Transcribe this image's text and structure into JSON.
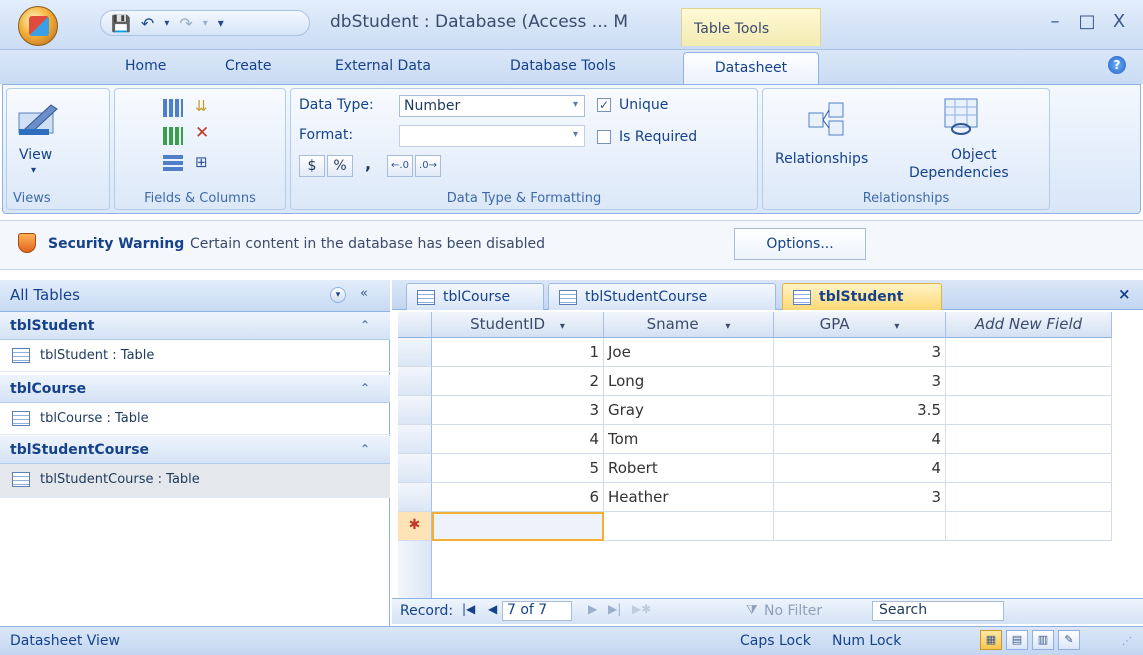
{
  "window": {
    "title": "dbStudent : Database (Access ... M",
    "context_tab": "Table Tools",
    "minimize": "–",
    "maximize": "□",
    "close": "X"
  },
  "ribbon_tabs": [
    "Home",
    "Create",
    "External Data",
    "Database Tools",
    "Datasheet"
  ],
  "ribbon": {
    "views": {
      "view_label": "View",
      "group": "Views"
    },
    "fields": {
      "group": "Fields & Columns"
    },
    "formatting": {
      "data_type_label": "Data Type:",
      "data_type_value": "Number",
      "format_label": "Format:",
      "format_value": "",
      "unique_label": "Unique",
      "required_label": "Is Required",
      "currency": "$",
      "percent": "%",
      "comma": ",",
      "group": "Data Type & Formatting"
    },
    "relationships": {
      "relationships_label": "Relationships",
      "object_label_1": "Object",
      "object_label_2": "Dependencies",
      "group": "Relationships"
    }
  },
  "security": {
    "title": "Security Warning",
    "message": "Certain content in the database has been disabled",
    "options": "Options..."
  },
  "nav": {
    "header": "All Tables",
    "groups": [
      {
        "name": "tblStudent",
        "item": "tblStudent : Table"
      },
      {
        "name": "tblCourse",
        "item": "tblCourse : Table"
      },
      {
        "name": "tblStudentCourse",
        "item": "tblStudentCourse : Table"
      }
    ]
  },
  "doc_tabs": [
    "tblCourse",
    "tblStudentCourse",
    "tblStudent"
  ],
  "table": {
    "columns": [
      "StudentID",
      "Sname",
      "GPA",
      "Add New Field"
    ],
    "rows": [
      [
        "1",
        "Joe",
        "3"
      ],
      [
        "2",
        "Long",
        "3"
      ],
      [
        "3",
        "Gray",
        "3.5"
      ],
      [
        "4",
        "Tom",
        "4"
      ],
      [
        "5",
        "Robert",
        "4"
      ],
      [
        "6",
        "Heather",
        "3"
      ]
    ],
    "new_row_marker": "✱"
  },
  "record_nav": {
    "label": "Record:",
    "position": "7 of 7",
    "filter": "No Filter",
    "search": "Search"
  },
  "status": {
    "view": "Datasheet View",
    "caps": "Caps Lock",
    "num": "Num Lock"
  }
}
